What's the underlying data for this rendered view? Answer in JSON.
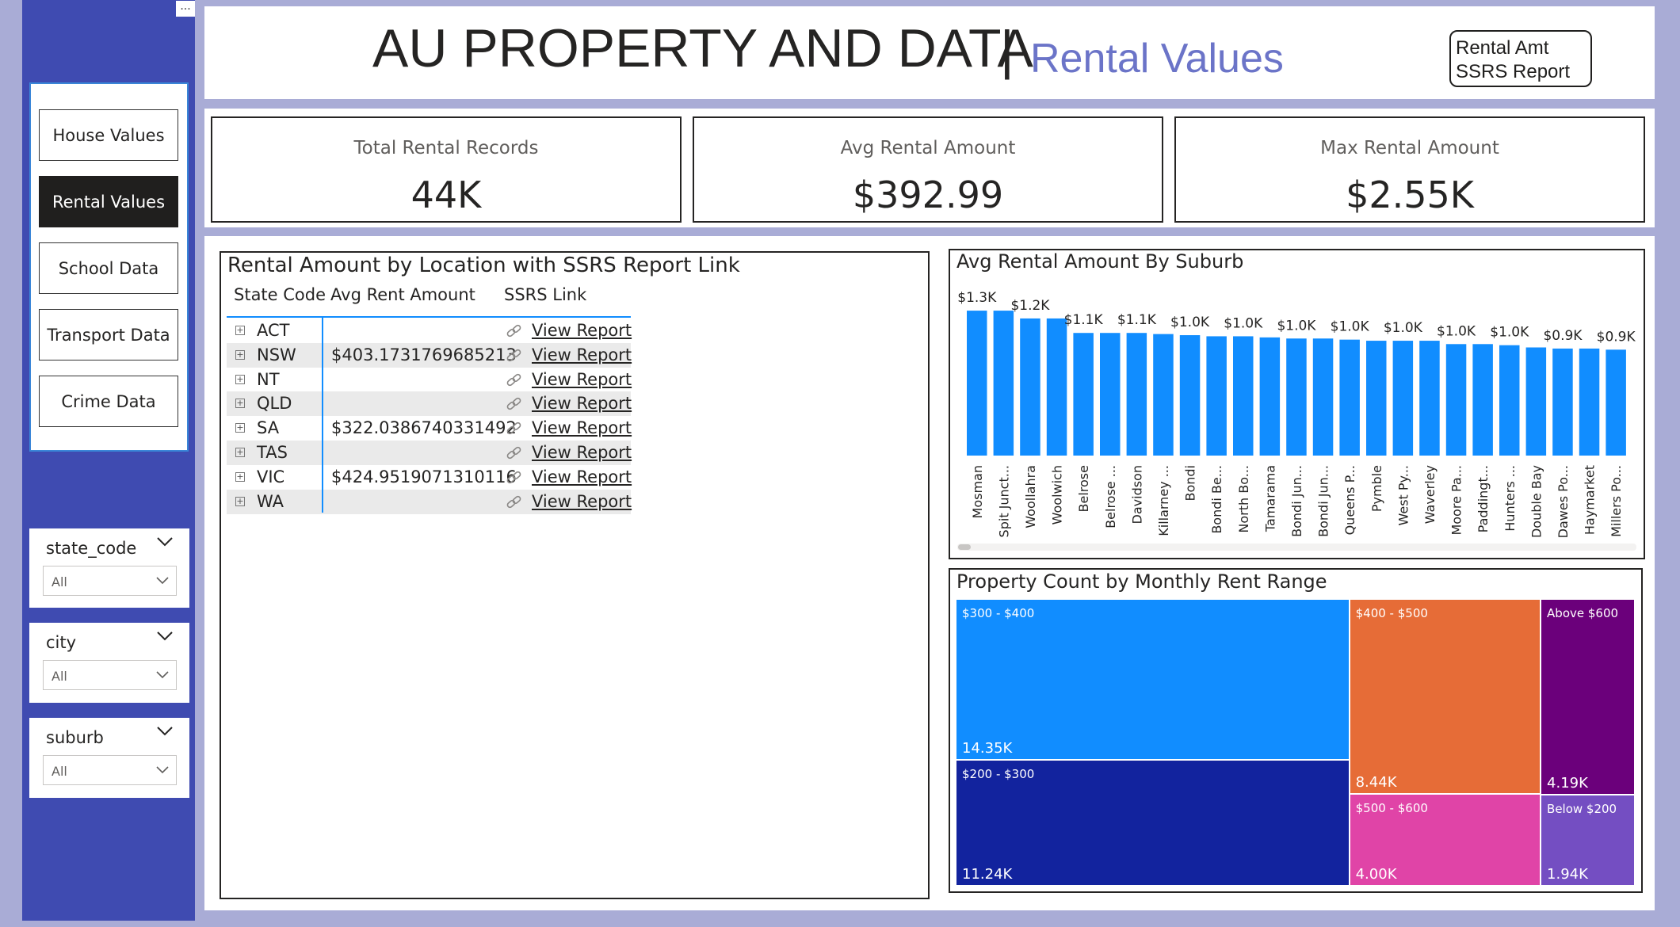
{
  "header": {
    "title": "AU PROPERTY AND DATA",
    "separator": "|",
    "subtitle": "Rental Values",
    "ssrs_button_line1": "Rental Amt",
    "ssrs_button_line2": "SSRS Report"
  },
  "sidebar": {
    "more_label": "...",
    "nav": [
      {
        "label": "House Values",
        "active": false
      },
      {
        "label": "Rental Values",
        "active": true
      },
      {
        "label": "School Data",
        "active": false
      },
      {
        "label": "Transport Data",
        "active": false
      },
      {
        "label": "Crime Data",
        "active": false
      }
    ],
    "slicers": [
      {
        "title": "state_code",
        "value": "All"
      },
      {
        "title": "city",
        "value": "All"
      },
      {
        "title": "suburb",
        "value": "All"
      }
    ]
  },
  "kpis": [
    {
      "label": "Total Rental Records",
      "value": "44K"
    },
    {
      "label": "Avg Rental Amount",
      "value": "$392.99"
    },
    {
      "label": "Max Rental Amount",
      "value": "$2.55K"
    }
  ],
  "table": {
    "title": "Rental Amount by Location with SSRS Report Link",
    "headers": [
      "State Code",
      "Avg Rent Amount",
      "SSRS Link"
    ],
    "expand_symbol": "+",
    "rows": [
      {
        "code": "ACT",
        "avg": "",
        "link": "View Report"
      },
      {
        "code": "NSW",
        "avg": "$403.1731769685213",
        "link": "View Report"
      },
      {
        "code": "NT",
        "avg": "",
        "link": "View Report"
      },
      {
        "code": "QLD",
        "avg": "",
        "link": "View Report"
      },
      {
        "code": "SA",
        "avg": "$322.0386740331492",
        "link": "View Report"
      },
      {
        "code": "TAS",
        "avg": "",
        "link": "View Report"
      },
      {
        "code": "VIC",
        "avg": "$424.9519071310116",
        "link": "View Report"
      },
      {
        "code": "WA",
        "avg": "",
        "link": "View Report"
      }
    ]
  },
  "colors": {
    "bar": "#118dff",
    "accent": "#6b74c8",
    "sidebar": "#3f4bb1"
  },
  "chart_data": [
    {
      "type": "bar",
      "title": "Avg Rental Amount By Suburb",
      "categories": [
        "Mosman",
        "Spit Junct...",
        "Woollahra",
        "Woolwich",
        "Belrose",
        "Belrose ...",
        "Davidson",
        "Killarney ...",
        "Bondi",
        "Bondi Be...",
        "North Bo...",
        "Tamarama",
        "Bondi Jun...",
        "Bondi Jun...",
        "Queens P...",
        "Pymble",
        "West Py...",
        "Waverley",
        "Moore Pa...",
        "Paddingt...",
        "Hunters ...",
        "Double Bay",
        "Dawes Po...",
        "Haymarket",
        "Millers Po..."
      ],
      "values": [
        1300,
        1300,
        1230,
        1230,
        1100,
        1100,
        1100,
        1090,
        1080,
        1070,
        1070,
        1060,
        1050,
        1050,
        1040,
        1030,
        1030,
        1030,
        1000,
        1000,
        990,
        970,
        960,
        960,
        950
      ],
      "data_labels": [
        "$1.3K",
        "",
        "$1.2K",
        "",
        "$1.1K",
        "",
        "$1.1K",
        "",
        "$1.0K",
        "",
        "$1.0K",
        "",
        "$1.0K",
        "",
        "$1.0K",
        "",
        "$1.0K",
        "",
        "$1.0K",
        "",
        "$1.0K",
        "",
        "$0.9K",
        "",
        "$0.9K"
      ],
      "ylim": [
        0,
        1400
      ],
      "grid": false
    },
    {
      "type": "treemap",
      "title": "Property Count by Monthly Rent Range",
      "items": [
        {
          "name": "$300 - $400",
          "label": "14.35K",
          "value": 14350,
          "color": "#118dff"
        },
        {
          "name": "$200 - $300",
          "label": "11.24K",
          "value": 11240,
          "color": "#12239e"
        },
        {
          "name": "$400 - $500",
          "label": "8.44K",
          "value": 8440,
          "color": "#e66c37"
        },
        {
          "name": "$500 - $600",
          "label": "4.00K",
          "value": 4000,
          "color": "#e044a7"
        },
        {
          "name": "Above $600",
          "label": "4.19K",
          "value": 4190,
          "color": "#6b007b"
        },
        {
          "name": "Below $200",
          "label": "1.94K",
          "value": 1940,
          "color": "#744ec2"
        }
      ]
    }
  ]
}
